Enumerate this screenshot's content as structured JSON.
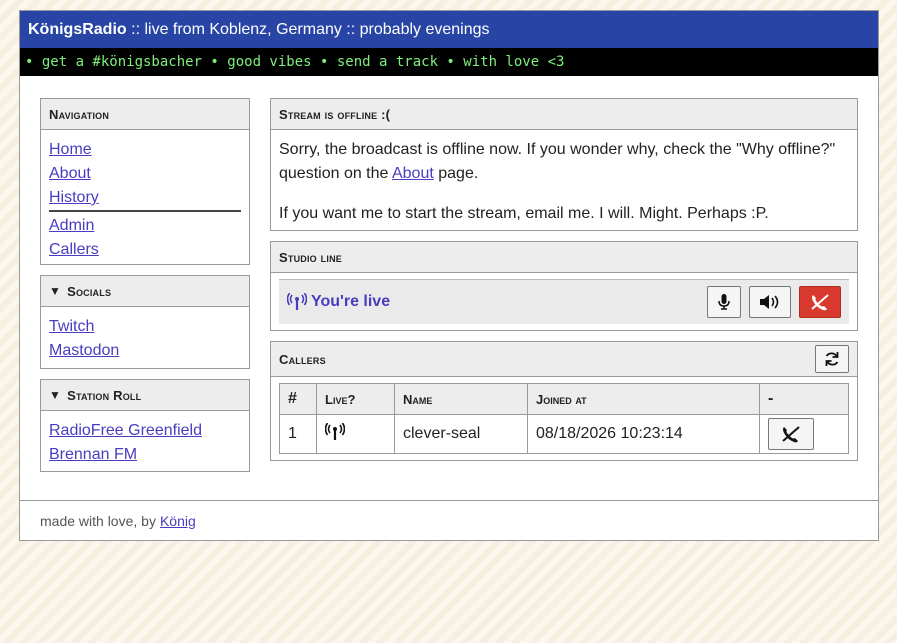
{
  "header": {
    "brand": "KönigsRadio",
    "tagline": " :: live from Koblenz, Germany :: probably evenings"
  },
  "marquee": "• get a #königsbacher • good vibes • send a track • with love <3",
  "navigation": {
    "title": "Navigation",
    "items": [
      "Home",
      "About",
      "History",
      "Admin",
      "Callers"
    ]
  },
  "socials": {
    "title": "Socials",
    "items": [
      "Twitch",
      "Mastodon"
    ]
  },
  "station_roll": {
    "title": "Station Roll",
    "items": [
      "RadioFree Greenfield",
      "Brennan FM"
    ]
  },
  "stream": {
    "title": "Stream is offline :(",
    "p1_before": "Sorry, the broadcast is offline now. If you wonder why, check the \"Why offline?\" question on the ",
    "p1_link": "About",
    "p1_after": " page.",
    "p2": "If you want me to start the stream, email me. I will. Might. Perhaps :P."
  },
  "studio": {
    "title": "Studio line",
    "status": "You're live"
  },
  "callers": {
    "title": "Callers",
    "columns": [
      "#",
      "Live?",
      "Name",
      "Joined at",
      "-"
    ],
    "rows": [
      {
        "num": "1",
        "name": "clever-seal",
        "joined": "08/18/2026 10:23:14"
      }
    ]
  },
  "footer": {
    "text": "made with love, by",
    "link": "König"
  },
  "colors": {
    "header_bg": "#2845a6",
    "link": "#4a3cc0",
    "marquee_fg": "#7ef07a",
    "danger": "#d93a2f"
  }
}
